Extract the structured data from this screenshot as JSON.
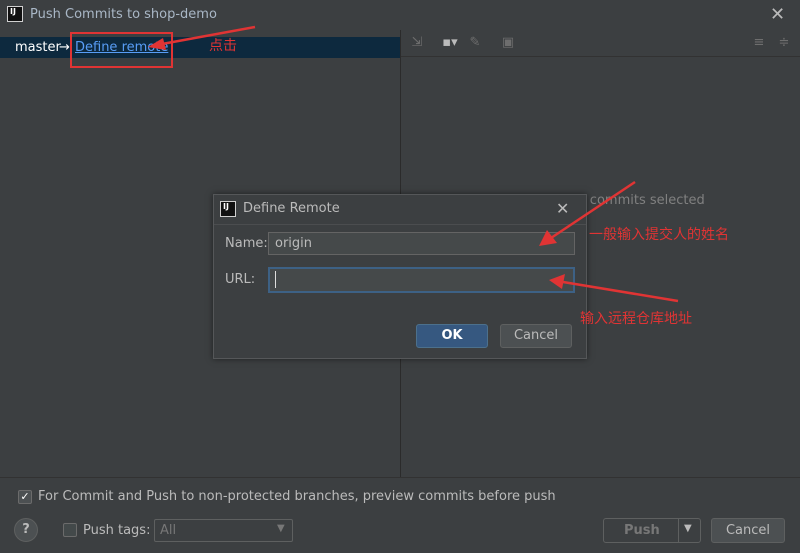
{
  "window": {
    "title": "Push Commits to shop-demo",
    "app_icon_text": "IJ",
    "close_glyph": "✕"
  },
  "left_panel": {
    "branch": "master",
    "arrow": "→",
    "define_remote_link": "Define remote"
  },
  "right_panel": {
    "empty_text": "No commits selected",
    "toolbar_icons": [
      "expand-icon",
      "group-icon",
      "edit-icon",
      "save-icon",
      "expand-all-icon",
      "collapse-all-icon"
    ]
  },
  "dialog": {
    "title": "Define Remote",
    "name_label": "Name:",
    "name_value": "origin",
    "url_label": "URL:",
    "url_value": "",
    "ok_label": "OK",
    "cancel_label": "Cancel"
  },
  "footer": {
    "preview_checkbox_checked": true,
    "preview_label": "For Commit and Push to non-protected branches, preview commits before push",
    "help_label": "?",
    "push_tags_checked": false,
    "push_tags_label": "Push tags:",
    "tags_select_value": "All",
    "push_label": "Push",
    "cancel_label": "Cancel"
  },
  "annotations": {
    "click_note": "点击",
    "name_note": "一般输入提交人的姓名",
    "url_note": "输入远程仓库地址",
    "color": "#e03434"
  },
  "colors": {
    "background": "#3c3f41",
    "selection": "#0d293e",
    "link": "#589df6",
    "ok_button": "#365880"
  }
}
